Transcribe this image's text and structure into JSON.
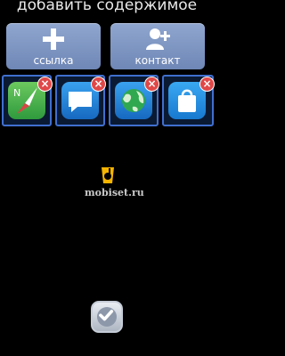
{
  "header": {
    "title": "добавить содержимое"
  },
  "actions": {
    "link_label": "ссылка",
    "contact_label": "контакт"
  },
  "tiles": [
    {
      "icon": "compass-icon",
      "color": "#3fae49",
      "close": "×"
    },
    {
      "icon": "chat-bubble-icon",
      "color": "#1e7fd6",
      "close": "×"
    },
    {
      "icon": "globe-icon",
      "color": "#1e7fd6",
      "close": "×"
    },
    {
      "icon": "shopping-bag-icon",
      "color": "#1e8be0",
      "close": "×"
    }
  ],
  "watermark": {
    "text": "mobiset.ru"
  },
  "footer": {
    "confirm_icon": "checkmark-icon"
  }
}
